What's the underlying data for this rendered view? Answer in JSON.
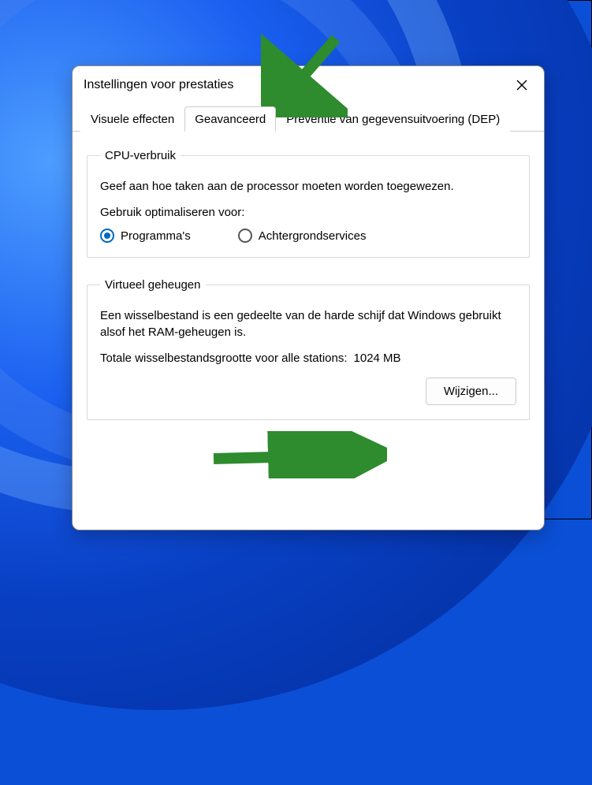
{
  "window": {
    "title": "Instellingen voor prestaties"
  },
  "tabs": [
    {
      "label": "Visuele effecten"
    },
    {
      "label": "Geavanceerd"
    },
    {
      "label": "Preventie van gegevensuitvoering (DEP)"
    }
  ],
  "cpu": {
    "legend": "CPU-verbruik",
    "desc": "Geef aan hoe taken aan de processor moeten worden toegewezen.",
    "subhead": "Gebruik optimaliseren voor:",
    "opt_programs": "Programma's",
    "opt_background": "Achtergrondservices"
  },
  "vm": {
    "legend": "Virtueel geheugen",
    "desc": "Een wisselbestand is een gedeelte van de harde schijf dat Windows gebruikt alsof het RAM-geheugen is.",
    "total_label": "Totale wisselbestandsgrootte voor alle stations:",
    "total_value": "1024 MB",
    "change_button": "Wijzigen..."
  }
}
